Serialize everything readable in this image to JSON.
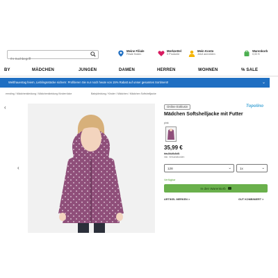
{
  "header": {
    "search_placeholder": "Ihr Suchbegriff",
    "items": [
      {
        "title": "Meine Filiale",
        "sub": "Filiale finden",
        "icon": "location-pin-icon",
        "color": "#1f6fc2"
      },
      {
        "title": "Merkzettel",
        "sub": "0 Produkte",
        "icon": "heart-icon",
        "color": "#d81b60"
      },
      {
        "title": "Mein Konto",
        "sub": "Jetzt anmelden",
        "icon": "user-icon",
        "color": "#f5b400"
      },
      {
        "title": "Warenkorb",
        "sub": "0,00 €",
        "icon": "cart-icon",
        "color": "#4caf50"
      }
    ]
  },
  "nav": [
    "BY",
    "MÄDCHEN",
    "JUNGEN",
    "DAMEN",
    "HERREN",
    "WOHNEN",
    "% SALE"
  ],
  "banner": {
    "text": "Weltfrauentag feiern, Lieblingsstücke sichern: Profitieren Sie nur noch heute von 15% Rabatt auf unser gesamtes Sortiment!"
  },
  "breadcrumb": {
    "left": [
      "ernsting",
      "Mädchenkleidung",
      "Mädchenkleidung Kinderröcke"
    ],
    "right": [
      "Babykleidung",
      "Kinder",
      "Mädchen",
      "Mädchen Softshelljacke"
    ]
  },
  "product": {
    "badge": "Online Exklusiv",
    "title": "Mädchen Softshelljacke mit Futter",
    "brand": "Topolino",
    "color_label": "pink",
    "price": "35,99 €",
    "old_price": "bis 39,95 AVE",
    "vat": "inkl. Versandkosten",
    "size_value": "128",
    "qty_value": "1x",
    "availability": "Verfügbar",
    "cart_label": "In den Warenkorb",
    "link_left": "ARTIKEL MERKEN >",
    "link_right": "GUT KOMBINIERT >"
  },
  "colors": {
    "jacket": "#8f4f7a",
    "accent": "#1f6fc2",
    "cart_green": "#6ab04c"
  }
}
